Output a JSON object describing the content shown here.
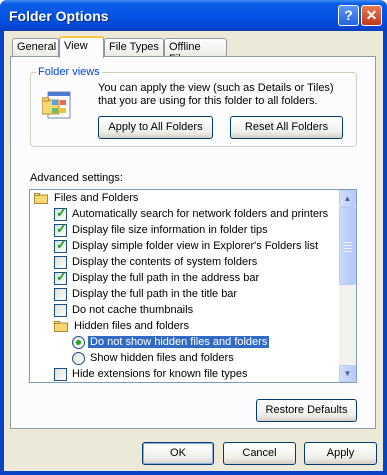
{
  "window": {
    "title": "Folder Options",
    "help_label": "?",
    "close_label": "✕"
  },
  "tabs": [
    {
      "label": "General"
    },
    {
      "label": "View"
    },
    {
      "label": "File Types"
    },
    {
      "label": "Offline Files"
    }
  ],
  "folder_views": {
    "label": "Folder views",
    "description": "You can apply the view (such as Details or Tiles) that you are using for this folder to all folders.",
    "apply_button": "Apply to All Folders",
    "reset_button": "Reset All Folders",
    "icon": "folder-view-icon"
  },
  "advanced": {
    "label": "Advanced settings:",
    "items": [
      {
        "label": "Files and Folders",
        "kind": "folder"
      },
      {
        "label": "Automatically search for network folders and printers",
        "kind": "checkbox",
        "checked": true
      },
      {
        "label": "Display file size information in folder tips",
        "kind": "checkbox",
        "checked": true
      },
      {
        "label": "Display simple folder view in Explorer's Folders list",
        "kind": "checkbox",
        "checked": true
      },
      {
        "label": "Display the contents of system folders",
        "kind": "checkbox",
        "checked": false
      },
      {
        "label": "Display the full path in the address bar",
        "kind": "checkbox",
        "checked": true
      },
      {
        "label": "Display the full path in the title bar",
        "kind": "checkbox",
        "checked": false
      },
      {
        "label": "Do not cache thumbnails",
        "kind": "checkbox",
        "checked": false
      },
      {
        "label": "Hidden files and folders",
        "kind": "folder"
      },
      {
        "label": "Do not show hidden files and folders",
        "kind": "radio",
        "checked": true,
        "selected": true
      },
      {
        "label": "Show hidden files and folders",
        "kind": "radio",
        "checked": false
      },
      {
        "label": "Hide extensions for known file types",
        "kind": "checkbox",
        "checked": false
      }
    ]
  },
  "restore_button": "Restore Defaults",
  "footer": {
    "ok": "OK",
    "cancel": "Cancel",
    "apply": "Apply"
  },
  "colors": {
    "titlebar": "#0554e3",
    "face": "#ece9d8",
    "selection": "#316ac5",
    "group_label": "#0046d5"
  }
}
